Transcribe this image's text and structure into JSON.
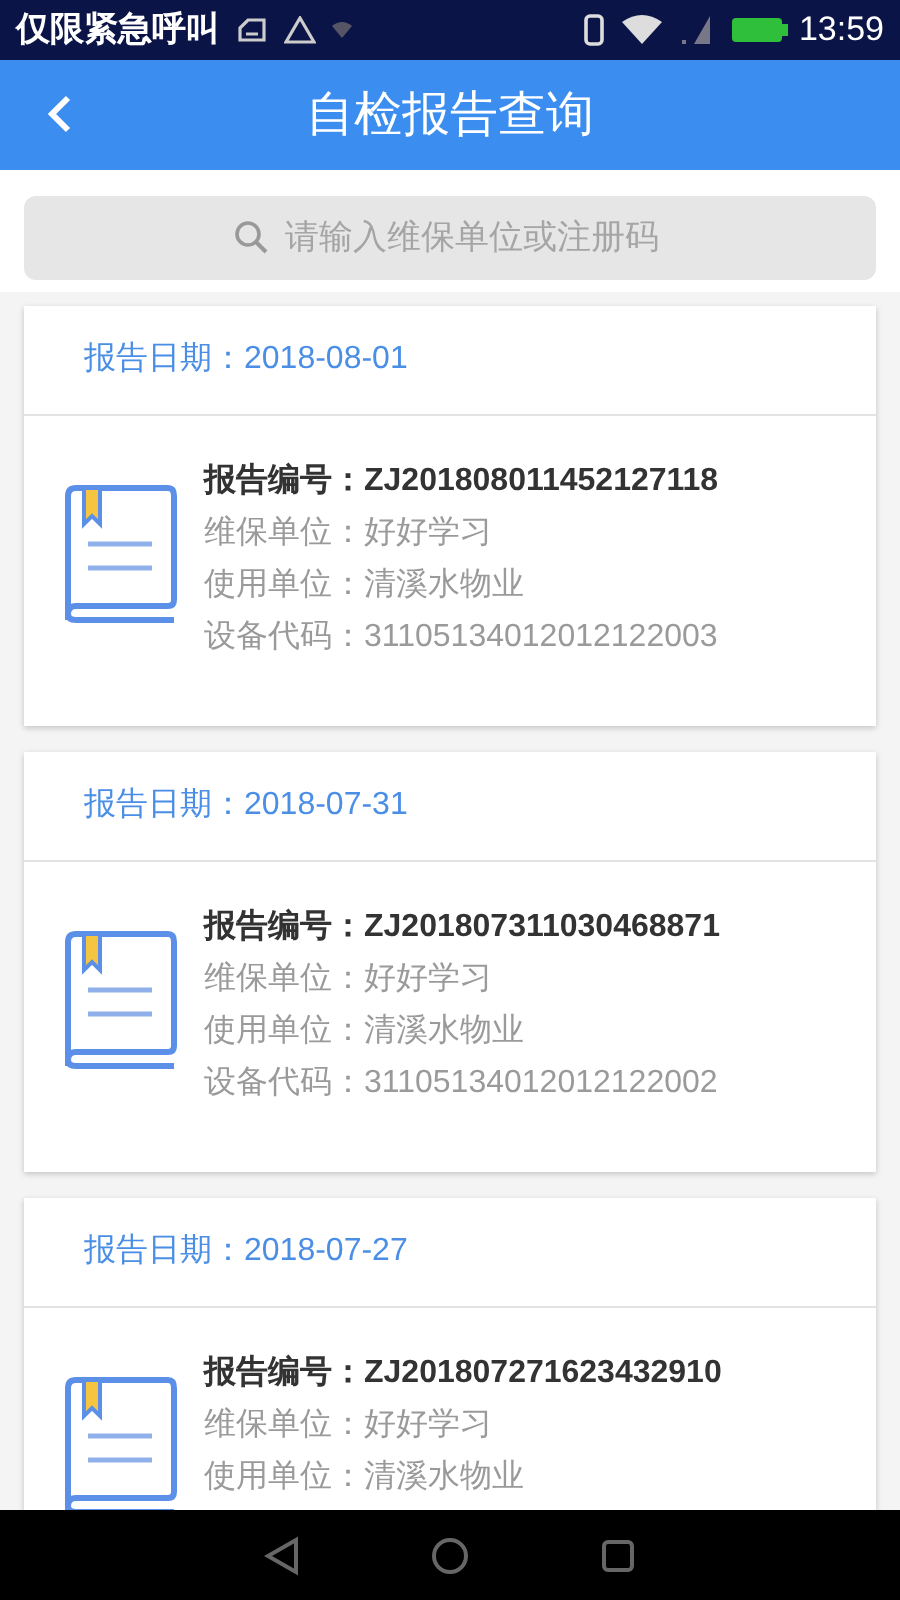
{
  "status_bar": {
    "carrier": "仅限紧急呼叫",
    "time": "13:59"
  },
  "app_bar": {
    "title": "自检报告查询"
  },
  "search": {
    "placeholder": "请输入维保单位或注册码"
  },
  "reports": [
    {
      "date_label": "报告日期：",
      "date": "2018-08-01",
      "number_label": "报告编号：",
      "number": "ZJ201808011452127118",
      "fields": [
        {
          "label": "维保单位：",
          "value": "好好学习"
        },
        {
          "label": "使用单位：",
          "value": "清溪水物业"
        },
        {
          "label": "设备代码：",
          "value": "31105134012012122003"
        }
      ]
    },
    {
      "date_label": "报告日期：",
      "date": "2018-07-31",
      "number_label": "报告编号：",
      "number": "ZJ201807311030468871",
      "fields": [
        {
          "label": "维保单位：",
          "value": "好好学习"
        },
        {
          "label": "使用单位：",
          "value": "清溪水物业"
        },
        {
          "label": "设备代码：",
          "value": "31105134012012122002"
        }
      ]
    },
    {
      "date_label": "报告日期：",
      "date": "2018-07-27",
      "number_label": "报告编号：",
      "number": "ZJ201807271623432910",
      "fields": [
        {
          "label": "维保单位：",
          "value": "好好学习"
        },
        {
          "label": "使用单位：",
          "value": "清溪水物业"
        }
      ]
    }
  ]
}
